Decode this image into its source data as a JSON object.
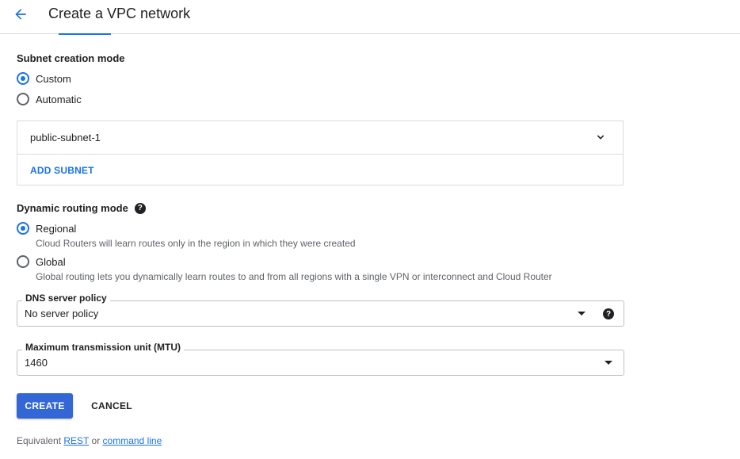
{
  "header": {
    "title": "Create a VPC network",
    "back_icon": "arrow-back-icon"
  },
  "subnet_mode": {
    "label": "Subnet creation mode",
    "options": [
      {
        "label": "Custom",
        "selected": true
      },
      {
        "label": "Automatic",
        "selected": false
      }
    ]
  },
  "subnets": {
    "items": [
      {
        "name": "public-subnet-1",
        "expand_icon": "chevron-down-icon"
      }
    ],
    "add_label": "ADD SUBNET"
  },
  "routing": {
    "label": "Dynamic routing mode",
    "help_icon": "help-circle-icon",
    "options": [
      {
        "label": "Regional",
        "description": "Cloud Routers will learn routes only in the region in which they were created",
        "selected": true
      },
      {
        "label": "Global",
        "description": "Global routing lets you dynamically learn routes to and from all regions with a single VPN or interconnect and Cloud Router",
        "selected": false
      }
    ]
  },
  "dns_policy": {
    "label": "DNS server policy",
    "value": "No server policy",
    "help_icon": "help-circle-icon"
  },
  "mtu": {
    "label": "Maximum transmission unit (MTU)",
    "value": "1460"
  },
  "actions": {
    "create_label": "CREATE",
    "cancel_label": "CANCEL"
  },
  "footer": {
    "prefix": "Equivalent",
    "rest_link": "REST",
    "or_text": "or",
    "cli_link": "command line"
  },
  "colors": {
    "accent": "#1a73e8",
    "primary_button": "#3367d6",
    "border": "#dadce0"
  }
}
